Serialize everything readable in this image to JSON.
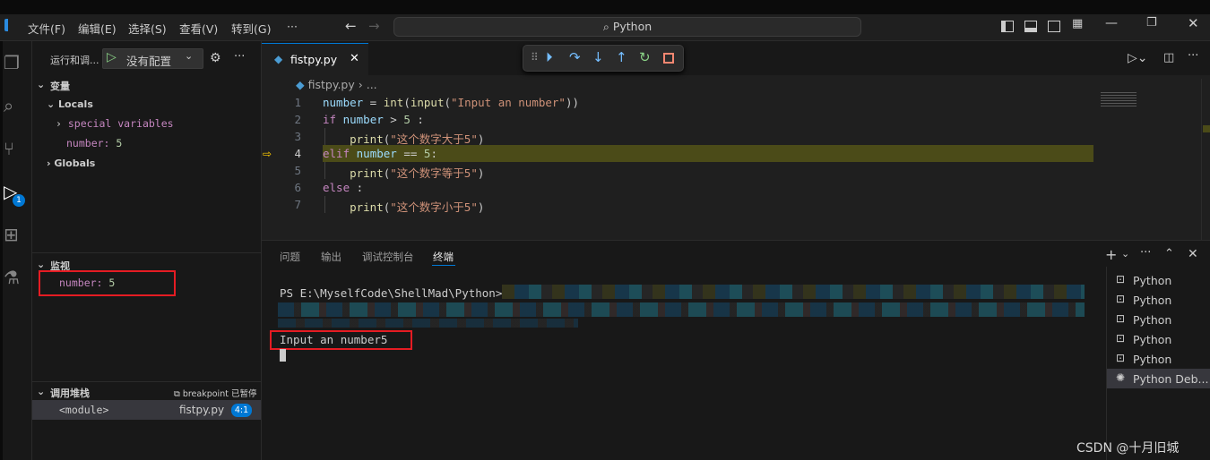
{
  "titlebar": {
    "menus": [
      "文件(F)",
      "编辑(E)",
      "选择(S)",
      "查看(V)",
      "转到(G)",
      "···"
    ],
    "search": "Python"
  },
  "activity": {
    "debug_badge": "1"
  },
  "sidebar": {
    "run_label": "运行和调...",
    "config": "没有配置",
    "variables_title": "变量",
    "locals": "Locals",
    "special": "special variables",
    "number_key": "number:",
    "number_val": "5",
    "globals": "Globals",
    "watch_title": "监视",
    "watch_key": "number:",
    "watch_val": "5",
    "callstack_title": "调用堆栈",
    "callstack_status": "breakpoint 已暂停",
    "frame_name": "<module>",
    "frame_file": "fistpy.py",
    "frame_pos": "4:1"
  },
  "editor": {
    "tab": "fistpy.py",
    "breadcrumb_file": "fistpy.py",
    "breadcrumb_more": "...",
    "lines": [
      {
        "n": "1",
        "t": [
          [
            "var",
            "number"
          ],
          [
            "pl",
            " = "
          ],
          [
            "fn",
            "int"
          ],
          [
            "pl",
            "("
          ],
          [
            "fn",
            "input"
          ],
          [
            "pl",
            "("
          ],
          [
            "str",
            "\"Input an number\""
          ],
          [
            "pl",
            "))"
          ]
        ]
      },
      {
        "n": "2",
        "t": [
          [
            "kw",
            "if"
          ],
          [
            "pl",
            " "
          ],
          [
            "var",
            "number"
          ],
          [
            "pl",
            " > "
          ],
          [
            "num",
            "5"
          ],
          [
            "pl",
            " :"
          ]
        ]
      },
      {
        "n": "3",
        "t": [
          [
            "pl",
            "    "
          ],
          [
            "fn",
            "print"
          ],
          [
            "pl",
            "("
          ],
          [
            "str",
            "\"这个数字大于5\""
          ],
          [
            "pl",
            ")"
          ]
        ]
      },
      {
        "n": "4",
        "t": [
          [
            "kw",
            "elif"
          ],
          [
            "pl",
            " "
          ],
          [
            "var",
            "number"
          ],
          [
            "pl",
            " == "
          ],
          [
            "num",
            "5"
          ],
          [
            "pl",
            ":"
          ]
        ]
      },
      {
        "n": "5",
        "t": [
          [
            "pl",
            "    "
          ],
          [
            "fn",
            "print"
          ],
          [
            "pl",
            "("
          ],
          [
            "str",
            "\"这个数字等于5\""
          ],
          [
            "pl",
            ")"
          ]
        ]
      },
      {
        "n": "6",
        "t": [
          [
            "kw",
            "else"
          ],
          [
            "pl",
            " :"
          ]
        ]
      },
      {
        "n": "7",
        "t": [
          [
            "pl",
            "    "
          ],
          [
            "fn",
            "print"
          ],
          [
            "pl",
            "("
          ],
          [
            "str",
            "\"这个数字小于5\""
          ],
          [
            "pl",
            ")"
          ]
        ]
      }
    ],
    "current_line": "4"
  },
  "panel": {
    "tabs": [
      "问题",
      "输出",
      "调试控制台",
      "终端"
    ],
    "active_tab": "终端",
    "prompt": "PS E:\\MyselfCode\\ShellMad\\Python>",
    "input_line": "Input an number5",
    "terminals": [
      "Python",
      "Python",
      "Python",
      "Python",
      "Python",
      "Python Deb..."
    ]
  },
  "watermark": "CSDN @十月旧城",
  "colors": {
    "accent": "#0078d4",
    "highlight": "#4b4b18",
    "redbox": "#e51c23"
  }
}
